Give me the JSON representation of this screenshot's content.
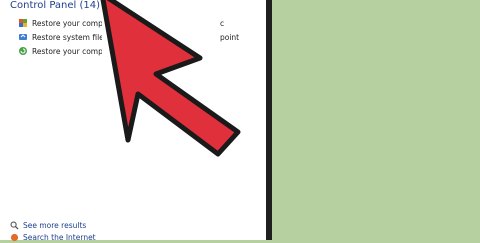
{
  "search_panel": {
    "section_title": "Control Panel (14)",
    "results": [
      {
        "label": "Restore your computer",
        "tail": "c",
        "icon": "flag-icon"
      },
      {
        "label": "Restore system files",
        "tail": "point",
        "icon": "system-restore-icon"
      },
      {
        "label": "Restore your computer",
        "tail": "",
        "icon": "recovery-icon"
      }
    ],
    "see_more": "See more results",
    "search_internet": "Search the Internet"
  },
  "overlay": {
    "arrow_color": "#e0303c",
    "arrow_outline": "#1a1a1a"
  },
  "colors": {
    "background": "#b6d19f",
    "panel": "#ffffff",
    "title": "#1f3f8f"
  }
}
